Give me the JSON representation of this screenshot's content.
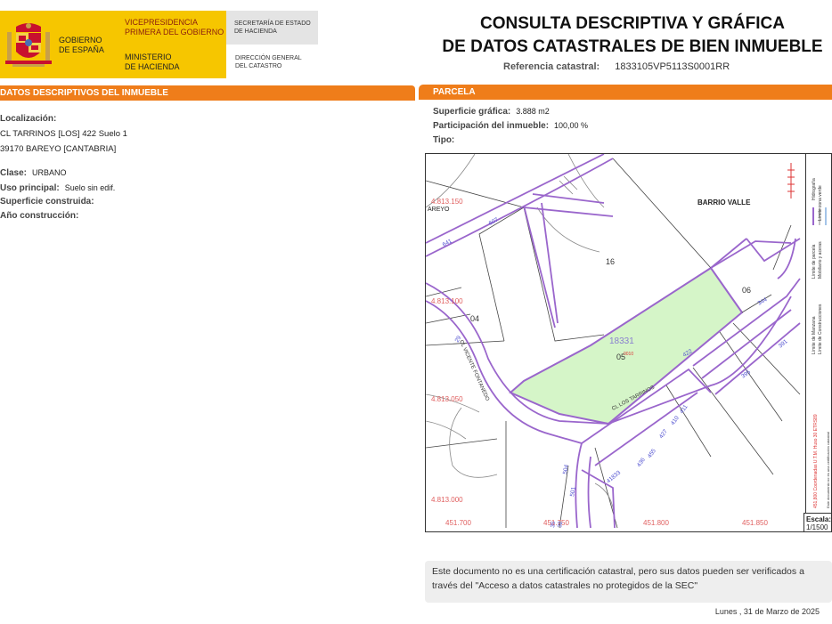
{
  "header": {
    "gobierno": [
      "GOBIERNO",
      "DE ESPAÑA"
    ],
    "vicepresidencia": [
      "VICEPRESIDENCIA",
      "PRIMERA DEL GOBIERNO"
    ],
    "ministerio": [
      "MINISTERIO",
      "DE HACIENDA"
    ],
    "secretaria": [
      "SECRETARÍA DE ESTADO",
      "DE HACIENDA"
    ],
    "direccion": [
      "DIRECCIÓN GENERAL",
      "DEL CATASTRO"
    ]
  },
  "title": {
    "line1": "CONSULTA DESCRIPTIVA Y GRÁFICA",
    "line2": "DE DATOS CATASTRALES DE BIEN INMUEBLE",
    "ref_label": "Referencia catastral:",
    "ref_value": "1833105VP5113S0001RR"
  },
  "inmueble": {
    "bar": "DATOS DESCRIPTIVOS DEL INMUEBLE",
    "localizacion_label": "Localización:",
    "direccion1": "CL TARRINOS [LOS] 422 Suelo 1",
    "direccion2": "39170 BAREYO [CANTABRIA]",
    "clase_label": "Clase:",
    "clase_value": "URBANO",
    "uso_label": "Uso principal:",
    "uso_value": "Suelo sin edif.",
    "superficie_label": "Superficie construida:",
    "anio_label": "Año construcción:"
  },
  "parcela": {
    "bar": "PARCELA",
    "superficie_label": "Superficie gráfica:",
    "superficie_value": "3.888 m2",
    "participacion_label": "Participación del inmueble:",
    "participacion_value": "100,00 %",
    "tipo_label": "Tipo:"
  },
  "map": {
    "y_coords": [
      "4.813.150",
      "4.813.100",
      "4.813.050",
      "4.813.000"
    ],
    "x_coords": [
      "451.700",
      "451.750",
      "451.800",
      "451.850"
    ],
    "place_barrio": "BARRIO VALLE",
    "place_bareyo": "AREYO",
    "parcel_ref": "18331",
    "parcel_labels": [
      "16",
      "06",
      "04",
      "05"
    ],
    "street_vicente": "CL VICENTE FONTANEDO",
    "street_tarrinos": "CL LOS TARRINOS",
    "numbers": [
      "607",
      "641",
      "422",
      "344",
      "391",
      "395",
      "504",
      "501",
      "455",
      "427",
      "410",
      "411",
      "436",
      "41833",
      "29",
      "35",
      "32"
    ],
    "parcel_small": "0010"
  },
  "legend": {
    "items": [
      "Límite de Manzana",
      "Límite de Construcciones",
      "Límite de parcela",
      "Mobiliario y aceras",
      "Límite zona verde",
      "Hidrografía"
    ],
    "coords_note": "451,800 Coordenadas U.T.M. Huso 30 ETRS89",
    "small_note": "Este documento no es una certificación catastral"
  },
  "scale": {
    "label": "Escala:",
    "value": "1/1500"
  },
  "notice": {
    "text": "Este documento no es una certificación catastral, pero sus datos pueden ser verificados a través del \"Acceso a datos catastrales no protegidos de la SEC\""
  },
  "date": "Lunes , 31 de Marzo de 2025",
  "colors": {
    "brand_yellow": "#f6c600",
    "section_orange": "#ef7d1a",
    "parcel_green": "#d5f5c8",
    "boundary_purple": "#9a66cc"
  }
}
